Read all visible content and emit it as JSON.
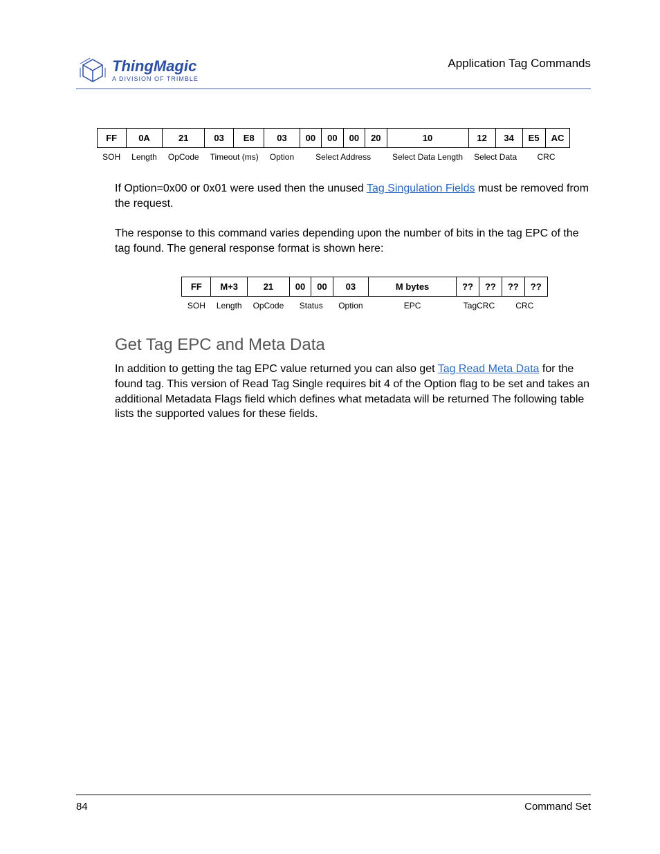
{
  "header": {
    "logo_main": "ThingMagic",
    "logo_sub": "A DIVISION OF TRIMBLE",
    "section": "Application Tag Commands"
  },
  "table1": {
    "values": [
      "FF",
      "0A",
      "21",
      "03",
      "E8",
      "03",
      "00",
      "00",
      "00",
      "20",
      "10",
      "12",
      "34",
      "E5",
      "AC"
    ],
    "labels": [
      "SOH",
      "Length",
      "OpCode",
      "Timeout (ms)",
      "Option",
      "Select Address",
      "Select Data Length",
      "Select Data",
      "CRC"
    ]
  },
  "p1_pre": "If Option=0x00 or 0x01 were used then the unused ",
  "p1_link": "Tag Singulation Fields",
  "p1_post": " must be removed from the request.",
  "p2": "The response to this command varies depending upon the number of bits in the tag EPC of the tag found. The general response format is shown here:",
  "table2": {
    "values": [
      "FF",
      "M+3",
      "21",
      "00",
      "00",
      "03",
      "M bytes",
      "??",
      "??",
      "??",
      "??"
    ],
    "labels": [
      "SOH",
      "Length",
      "OpCode",
      "Status",
      "Option",
      "EPC",
      "TagCRC",
      "CRC"
    ]
  },
  "heading": "Get Tag EPC and Meta Data",
  "p3_pre": "In addition to getting the tag EPC value returned you can also get ",
  "p3_link": "Tag Read Meta Data",
  "p3_post": " for the found tag. This version of Read Tag Single requires bit 4 of the Option flag to be set and takes an additional Metadata Flags field which defines what metadata will be returned The following table lists the supported values for these fields.",
  "footer": {
    "page": "84",
    "title": "Command Set"
  }
}
